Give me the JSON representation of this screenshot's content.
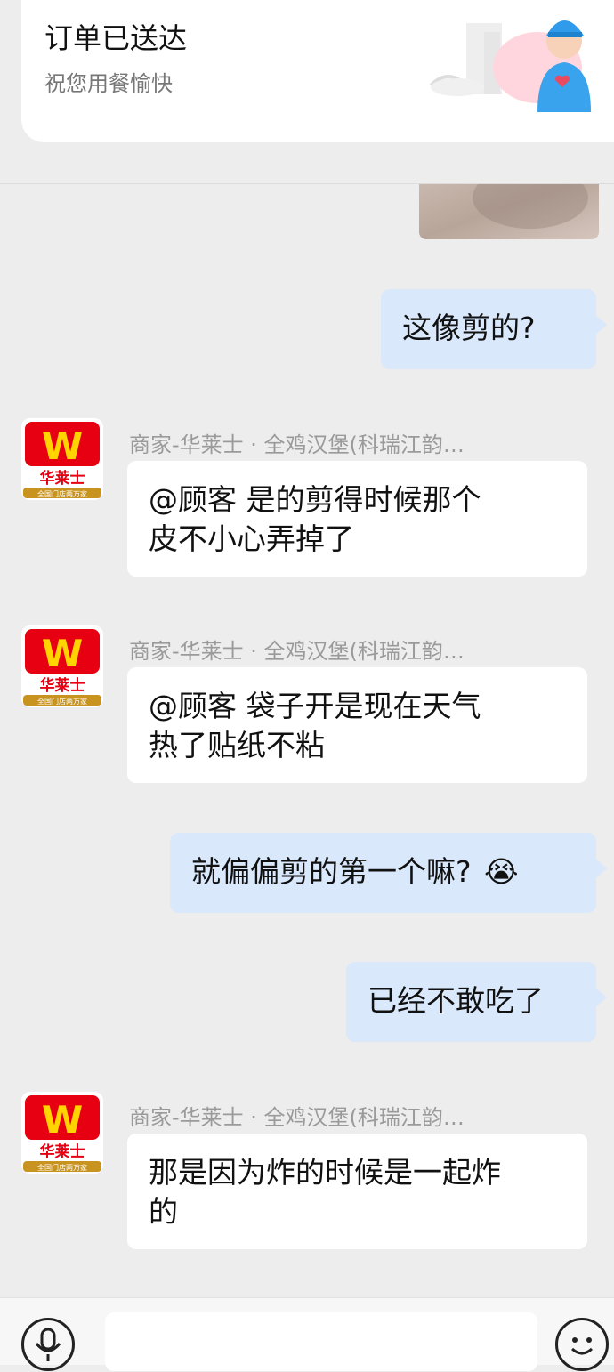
{
  "order": {
    "title": "订单已送达",
    "subtitle": "祝您用餐愉快"
  },
  "merchant_avatar": {
    "logo_letter": "W",
    "logo_name": "华莱士",
    "logo_tagline": "全国门店两万家"
  },
  "messages": [
    {
      "from": "customer",
      "text": "这像剪的?"
    },
    {
      "from": "merchant",
      "sender": "商家-华莱士 · 全鸡汉堡(科瑞江韵…",
      "lines": [
        "@顾客 是的剪得时候那个",
        "皮不小心弄掉了"
      ]
    },
    {
      "from": "merchant",
      "sender": "商家-华莱士 · 全鸡汉堡(科瑞江韵…",
      "lines": [
        "@顾客 袋子开是现在天气",
        "热了贴纸不粘"
      ]
    },
    {
      "from": "customer",
      "text": "就偏偏剪的第一个嘛?",
      "emoji": "😭"
    },
    {
      "from": "customer",
      "text": "已经不敢吃了"
    },
    {
      "from": "merchant",
      "sender": "商家-华莱士 · 全鸡汉堡(科瑞江韵…",
      "lines": [
        "那是因为炸的时候是一起炸",
        "的"
      ]
    }
  ],
  "input_bar": {
    "voice_icon": "microphone-icon",
    "emoji_icon": "smiley-icon",
    "text_value": ""
  },
  "colors": {
    "background": "#ededed",
    "customer_bubble": "#d9e8fb",
    "merchant_bubble": "#ffffff",
    "brand_red": "#e60012",
    "brand_yellow": "#ffd400"
  }
}
